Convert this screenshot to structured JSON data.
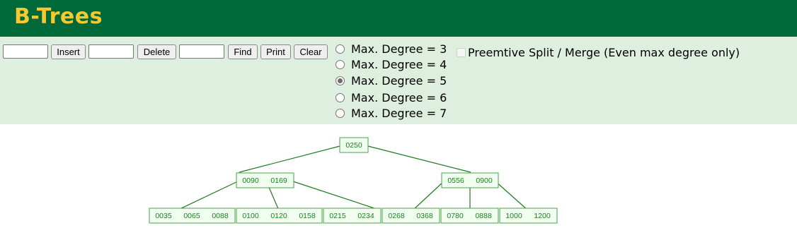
{
  "app": {
    "title": "B-Trees"
  },
  "controls": {
    "insert": {
      "value": "",
      "label": "Insert"
    },
    "delete": {
      "value": "",
      "label": "Delete"
    },
    "find": {
      "value": "",
      "label": "Find"
    },
    "print_label": "Print",
    "clear_label": "Clear",
    "degree_options": [
      {
        "label": "Max. Degree = 3",
        "selected": false
      },
      {
        "label": "Max. Degree = 4",
        "selected": false
      },
      {
        "label": "Max. Degree = 5",
        "selected": true
      },
      {
        "label": "Max. Degree = 6",
        "selected": false
      },
      {
        "label": "Max. Degree = 7",
        "selected": false
      }
    ],
    "preemptive": {
      "label": "Preemtive Split / Merge (Even max degree only)",
      "checked": false,
      "disabled": true
    }
  },
  "tree": {
    "root": {
      "keys": [
        "0250"
      ]
    },
    "level1": [
      {
        "keys": [
          "0090",
          "0169"
        ]
      },
      {
        "keys": [
          "0556",
          "0900"
        ]
      }
    ],
    "leaves": [
      {
        "keys": [
          "0035",
          "0065",
          "0088"
        ]
      },
      {
        "keys": [
          "0100",
          "0120",
          "0158"
        ]
      },
      {
        "keys": [
          "0215",
          "0234"
        ]
      },
      {
        "keys": [
          "0268",
          "0368"
        ]
      },
      {
        "keys": [
          "0780",
          "0888"
        ]
      },
      {
        "keys": [
          "1000",
          "1200"
        ]
      }
    ]
  },
  "colors": {
    "header_bg": "#00693a",
    "title": "#f7c82f",
    "controls_bg": "#dfefdf",
    "node_fill": "#f0fff0",
    "node_stroke": "#4aa04a",
    "key_text": "#1b7f1b",
    "edge": "#1f7a1f"
  }
}
